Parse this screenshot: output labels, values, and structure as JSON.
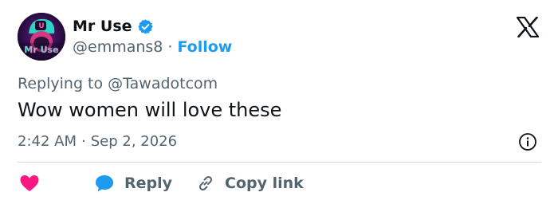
{
  "author": {
    "display_name": "Mr Use",
    "handle": "@emmans8",
    "follow_label": "Follow",
    "separator": "·",
    "avatar_text": "Mr Use",
    "avatar_badge": "U"
  },
  "reply": {
    "prefix": "Replying to",
    "mention": "@Tawadotcom"
  },
  "tweet": {
    "text": "Wow women will love these",
    "time": "2:42 AM",
    "separator": "·",
    "date": "Sep 2, 2026"
  },
  "actions": {
    "reply_label": "Reply",
    "copy_link_label": "Copy link"
  },
  "icons": {
    "verified": "verified-badge-icon",
    "x_logo": "x-logo-icon",
    "info": "info-icon",
    "heart": "heart-icon",
    "reply": "reply-bubble-icon",
    "link": "link-icon"
  },
  "colors": {
    "accent": "#1d9bf0",
    "heart": "#f91880",
    "text": "#0f1419",
    "secondary": "#536471",
    "divider": "#cfd9de"
  }
}
